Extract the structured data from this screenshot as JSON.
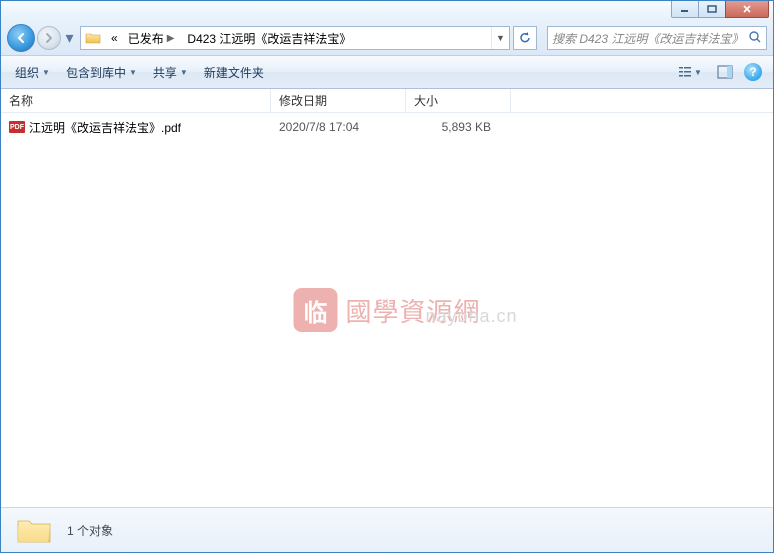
{
  "breadcrumb": {
    "parts": [
      "已发布",
      "D423 江远明《改运吉祥法宝》"
    ],
    "overflow": "«"
  },
  "search": {
    "placeholder": "搜索 D423 江远明《改运吉祥法宝》"
  },
  "toolbar": {
    "organize": "组织",
    "library": "包含到库中",
    "share": "共享",
    "newfolder": "新建文件夹"
  },
  "columns": {
    "name": "名称",
    "date": "修改日期",
    "size": "大小"
  },
  "files": [
    {
      "icon": "PDF",
      "name": "江远明《改运吉祥法宝》.pdf",
      "date": "2020/7/8 17:04",
      "size": "5,893 KB"
    }
  ],
  "status": {
    "count": "1 个对象"
  },
  "watermark": {
    "stamp": "临",
    "text1": "國學資源網",
    "text2": "nayona.cn"
  }
}
